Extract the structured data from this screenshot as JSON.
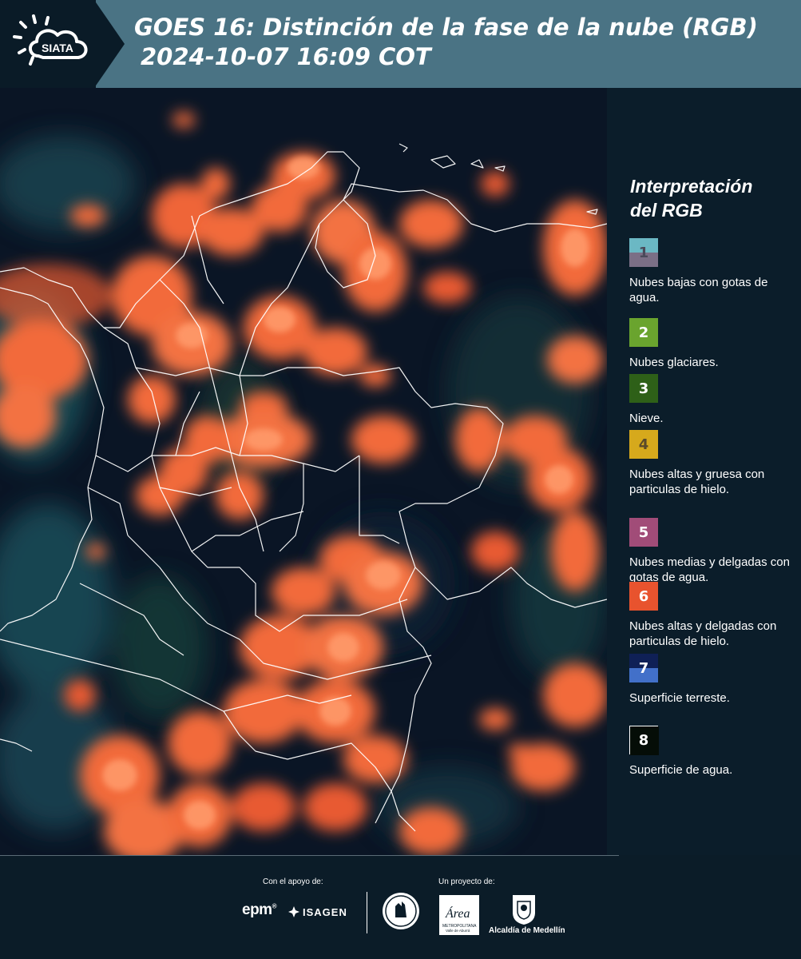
{
  "header": {
    "logo_text": "SIATA",
    "title_line1": "GOES 16: Distinción de la fase de la nube (RGB)",
    "title_line2": "2024-10-07 16:09 COT"
  },
  "legend": {
    "title_line1": "Interpretación",
    "title_line2": "del RGB",
    "items": [
      {
        "number": "1",
        "label": "Nubes bajas con gotas de agua.",
        "color_top": "#6bb8c4",
        "color_bottom": "#7b6f86",
        "text_color": "#4a4a5a"
      },
      {
        "number": "2",
        "label": "Nubes glaciares.",
        "color_top": "#6aa42e",
        "color_bottom": "#6aa42e",
        "text_color": "#ffffff"
      },
      {
        "number": "3",
        "label": "Nieve.",
        "color_top": "#2e6018",
        "color_bottom": "#2e6018",
        "text_color": "#ffffff"
      },
      {
        "number": "4",
        "label": "Nubes altas y gruesa con particulas de hielo.",
        "color_top": "#d6a91c",
        "color_bottom": "#d6a91c",
        "text_color": "#5a4a2a"
      },
      {
        "number": "5",
        "label": "Nubes medias y delgadas con gotas de agua.",
        "color_top": "#a14c78",
        "color_bottom": "#a14c78",
        "text_color": "#ffffff"
      },
      {
        "number": "6",
        "label": "Nubes altas y delgadas con particulas de hielo.",
        "color_top": "#e8532e",
        "color_bottom": "#e8532e",
        "text_color": "#ffffff"
      },
      {
        "number": "7",
        "label": "Superficie terreste.",
        "color_top": "#0f2056",
        "color_bottom": "#4270c9",
        "text_color": "#ffffff"
      },
      {
        "number": "8",
        "label": "Superficie de agua.",
        "color_top": "#050d07",
        "color_bottom": "#050d07",
        "text_color": "#ffffff"
      }
    ]
  },
  "footer": {
    "support_label": "Con el apoyo de:",
    "project_label": "Un proyecto de:",
    "epm_text": "epm",
    "isagen_text": "ISAGEN",
    "area_text": "Área",
    "area_sub1": "METROPOLITANA",
    "area_sub2": "Valle de Aburrá",
    "alcaldia_text": "Alcaldía de Medellín"
  },
  "colors": {
    "cloud_orange": "#f26a3a",
    "header_band": "#4a7384",
    "background": "#0b1c28"
  }
}
